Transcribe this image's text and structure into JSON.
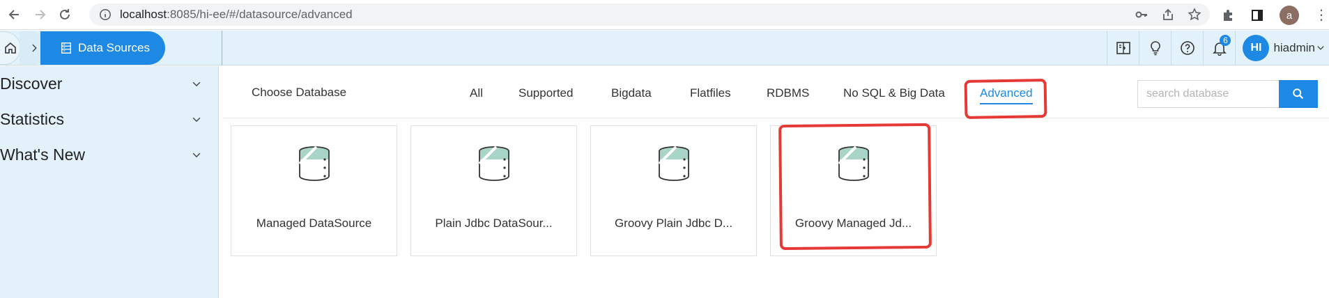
{
  "browser": {
    "url_host": "localhost",
    "url_rest": ":8085/hi-ee/#/datasource/advanced",
    "profile_initial": "a"
  },
  "header": {
    "breadcrumb_current": "Data Sources",
    "notification_count": "6",
    "user_initials": "HI",
    "user_name": "hiadmin"
  },
  "sidebar": {
    "items": [
      {
        "label": "Discover"
      },
      {
        "label": "Statistics"
      },
      {
        "label": "What's New"
      }
    ]
  },
  "main": {
    "choose_label": "Choose Database",
    "tabs": [
      {
        "label": "All"
      },
      {
        "label": "Supported"
      },
      {
        "label": "Bigdata"
      },
      {
        "label": "Flatfiles"
      },
      {
        "label": "RDBMS"
      },
      {
        "label": "No SQL & Big Data"
      },
      {
        "label": "Advanced",
        "active": true
      }
    ],
    "search_placeholder": "search database",
    "cards": [
      {
        "label": "Managed DataSource"
      },
      {
        "label": "Plain Jdbc DataSour..."
      },
      {
        "label": "Groovy Plain Jdbc D..."
      },
      {
        "label": "Groovy Managed Jd..."
      }
    ]
  },
  "colors": {
    "accent": "#1e88e5",
    "sidebar_bg": "#e3f2fa",
    "highlight": "#e53935"
  }
}
